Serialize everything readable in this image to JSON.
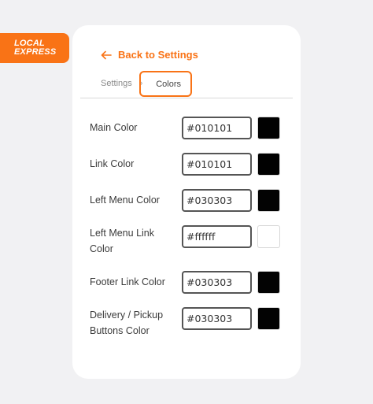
{
  "brand": {
    "line1": "LOCAL",
    "line2": "EXPRESS"
  },
  "back_link": "Back to Settings",
  "breadcrumb": {
    "parent": "Settings",
    "separator": "›",
    "current": "Colors"
  },
  "accent_color": "#f97316",
  "color_settings": [
    {
      "label": "Main Color",
      "value": "#010101",
      "swatch": "#010101"
    },
    {
      "label": "Link Color",
      "value": "#010101",
      "swatch": "#010101"
    },
    {
      "label": "Left Menu Color",
      "value": "#030303",
      "swatch": "#030303"
    },
    {
      "label": "Left Menu Link Color",
      "value": "#ffffff",
      "swatch": "#ffffff"
    },
    {
      "label": "Footer Link Color",
      "value": "#030303",
      "swatch": "#030303"
    },
    {
      "label": "Delivery / Pickup Buttons Color",
      "value": "#030303",
      "swatch": "#030303"
    }
  ]
}
